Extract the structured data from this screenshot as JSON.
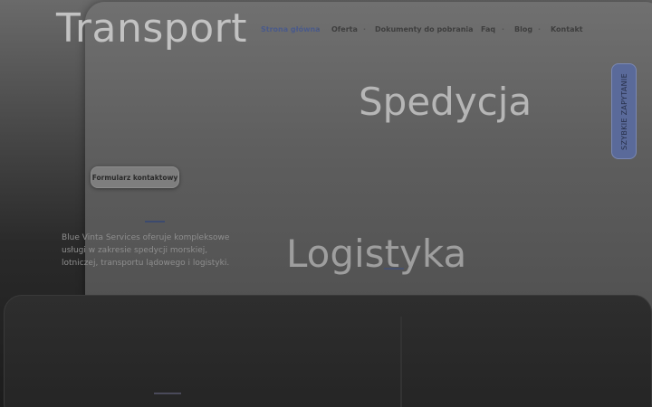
{
  "hero": {
    "word1": "Transport",
    "word2": "Spedycja",
    "word3": "Logistyka"
  },
  "nav": {
    "items": [
      {
        "label": "Strona główna",
        "active": true
      },
      {
        "label": "Oferta"
      },
      {
        "label": "Dokumenty do pobrania"
      },
      {
        "label": "Faq"
      },
      {
        "label": "Blog"
      },
      {
        "label": "Kontakt"
      }
    ]
  },
  "buttons": {
    "contact_form": "Formularz kontaktowy",
    "quick_quote": "SZYBKIE ZAPYTANIE"
  },
  "intro": {
    "text": "Blue Vinta Services oferuje kompleksowe usługi w zakresie spedycji morskiej, lotniczej, transportu lądowego i logistyki."
  },
  "colors": {
    "accent": "#5a6a9a",
    "nav_active": "#4a5a8a"
  }
}
